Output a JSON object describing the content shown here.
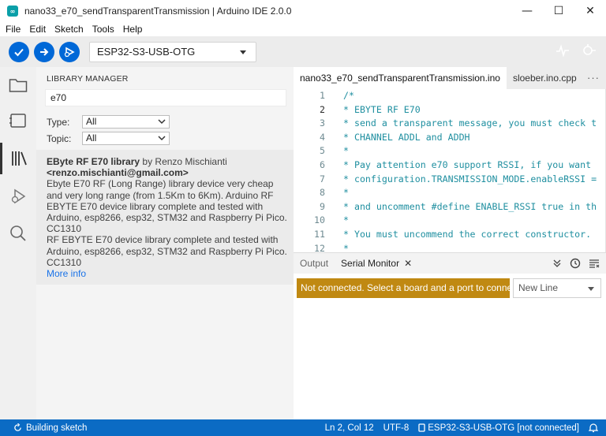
{
  "window": {
    "title": "nano33_e70_sendTransparentTransmission | Arduino IDE 2.0.0",
    "logo_text": "∞",
    "controls": {
      "minimize": "—",
      "maximize": "☐",
      "close": "✕"
    }
  },
  "menu": [
    "File",
    "Edit",
    "Sketch",
    "Tools",
    "Help"
  ],
  "toolbar": {
    "board": "ESP32-S3-USB-OTG",
    "buttons": [
      "verify-icon",
      "upload-icon",
      "debug-icon"
    ],
    "right_icons": [
      "serial-plotter-icon",
      "serial-monitor-icon"
    ]
  },
  "activity": [
    "folder-icon",
    "boards-manager-icon",
    "library-icon",
    "debug-icon",
    "search-icon"
  ],
  "library_manager": {
    "title": "LIBRARY MANAGER",
    "search_value": "e70",
    "type_label": "Type:",
    "type_value": "All",
    "topic_label": "Topic:",
    "topic_value": "All",
    "result": {
      "name": "EByte RF E70 library",
      "by": " by Renzo Mischianti",
      "email": "<renzo.mischianti@gmail.com>",
      "desc1": "Ebyte E70 RF (Long Range) library device very cheap and very long range (from 1.5Km to 6Km). Arduino RF EBYTE E70 device library complete and tested with Arduino, esp8266, esp32, STM32 and Raspberry Pi Pico. CC1310",
      "desc2": "RF EBYTE E70 device library complete and tested with Arduino, esp8266, esp32, STM32 and Raspberry Pi Pico. CC1310",
      "more_info": "More info"
    }
  },
  "editor": {
    "tabs": [
      "nano33_e70_sendTransparentTransmission.ino",
      "sloeber.ino.cpp"
    ],
    "more": "···",
    "lines": [
      {
        "n": "1",
        "t": "/*"
      },
      {
        "n": "2",
        "t": " * EBYTE RF E70"
      },
      {
        "n": "3",
        "t": " * send a transparent message, you must check t"
      },
      {
        "n": "4",
        "t": " * CHANNEL ADDL and ADDH"
      },
      {
        "n": "5",
        "t": " *"
      },
      {
        "n": "6",
        "t": " * Pay attention e70 support RSSI, if you want"
      },
      {
        "n": "7",
        "t": " * configuration.TRANSMISSION_MODE.enableRSSI ="
      },
      {
        "n": "8",
        "t": " *"
      },
      {
        "n": "9",
        "t": " * and uncomment #define ENABLE_RSSI true in th"
      },
      {
        "n": "10",
        "t": " *"
      },
      {
        "n": "11",
        "t": " * You must uncommend the correct constructor."
      },
      {
        "n": "12",
        "t": " *"
      }
    ]
  },
  "bottom_panel": {
    "tab_output": "Output",
    "tab_serial": "Serial Monitor",
    "close": "✕",
    "message": "Not connected. Select a board and a port to connect automatically.",
    "line_ending": "New Line"
  },
  "statusbar": {
    "building": "Building sketch",
    "position": "Ln 2, Col 12",
    "encoding": "UTF-8",
    "board_status": "ESP32-S3-USB-OTG [not connected]"
  }
}
